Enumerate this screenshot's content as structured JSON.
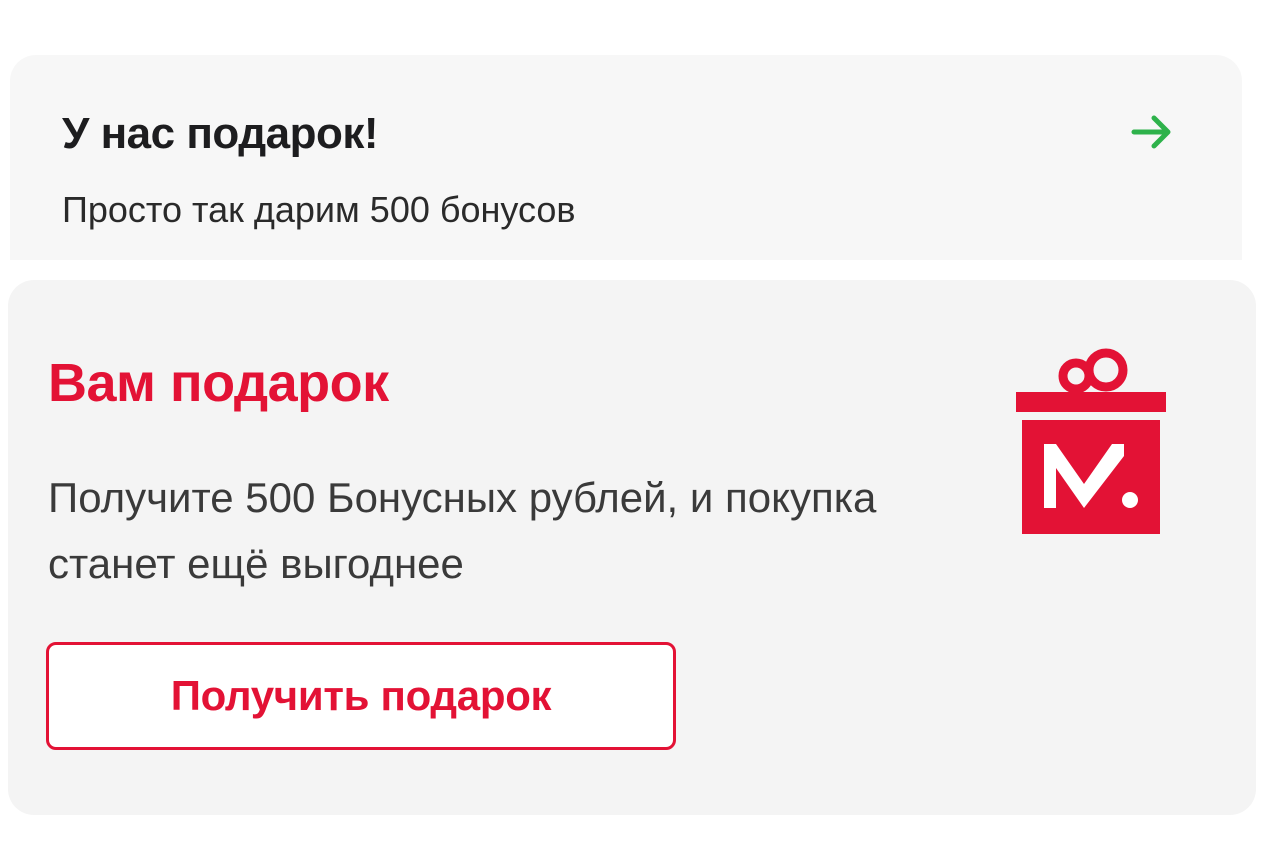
{
  "promo_banner": {
    "title": "У нас подарок!",
    "subtitle": "Просто так дарим 500 бонусов",
    "arrow_icon": "arrow-right-icon",
    "arrow_color": "#2eb24b"
  },
  "gift_card": {
    "title": "Вам подарок",
    "description": "Получите 500 Бонусных рублей, и покупка станет ещё выгоднее",
    "button_label": "Получить подарок",
    "icon": "gift-box-m-logo-icon",
    "accent_color": "#e31235"
  }
}
